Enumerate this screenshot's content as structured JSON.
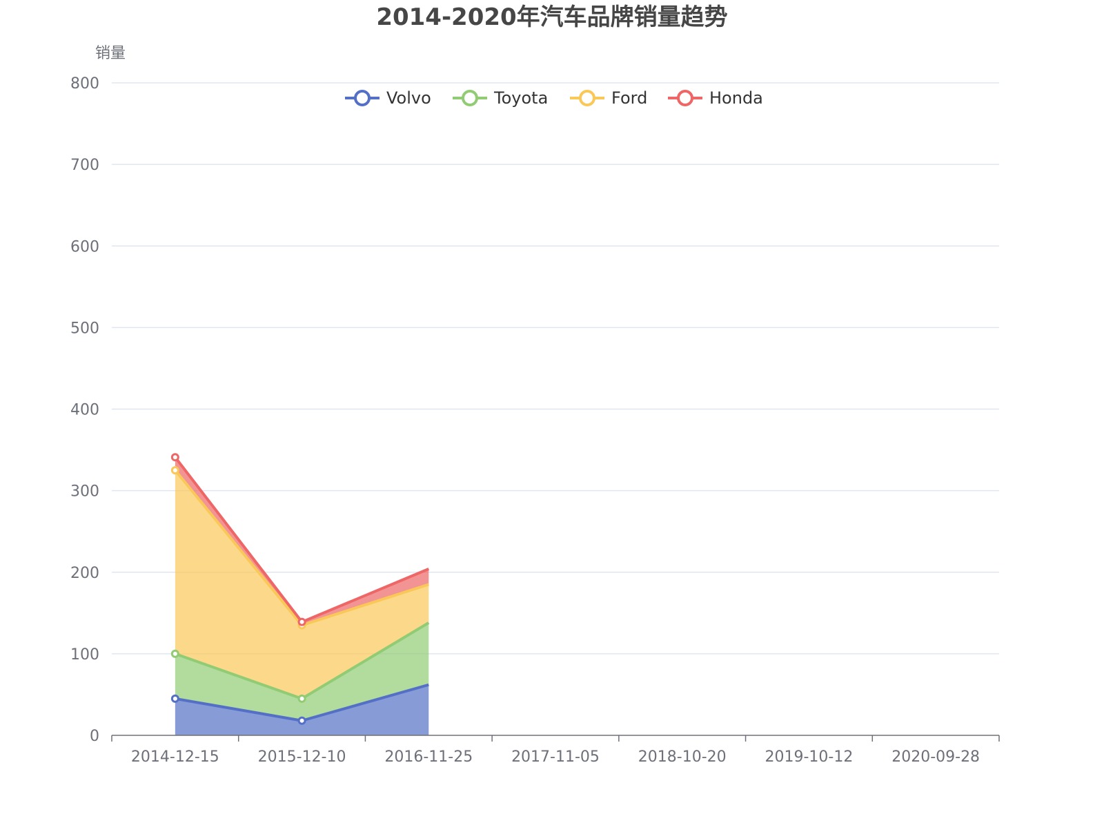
{
  "chart_data": {
    "type": "area",
    "stacked": true,
    "title": "2014-2020年汽车品牌销量趋势",
    "xlabel": "",
    "ylabel": "销量",
    "categories": [
      "2014-12-15",
      "2015-12-10",
      "2016-11-25",
      "2017-11-05",
      "2018-10-20",
      "2019-10-12",
      "2020-09-28"
    ],
    "ylim": [
      0,
      800
    ],
    "yticks": [
      0,
      100,
      200,
      300,
      400,
      500,
      600,
      700,
      800
    ],
    "grid": true,
    "legend_position": "top-center",
    "series": [
      {
        "name": "Volvo",
        "color": "#5470c6",
        "values": [
          45,
          18,
          62,
          null,
          null,
          null,
          null
        ]
      },
      {
        "name": "Toyota",
        "color": "#91cc75",
        "values": [
          55,
          27,
          76,
          null,
          null,
          null,
          null
        ]
      },
      {
        "name": "Ford",
        "color": "#fac858",
        "values": [
          225,
          90,
          47,
          null,
          null,
          null,
          null
        ]
      },
      {
        "name": "Honda",
        "color": "#ee6666",
        "values": [
          16,
          4,
          19,
          null,
          null,
          null,
          null
        ]
      }
    ]
  }
}
